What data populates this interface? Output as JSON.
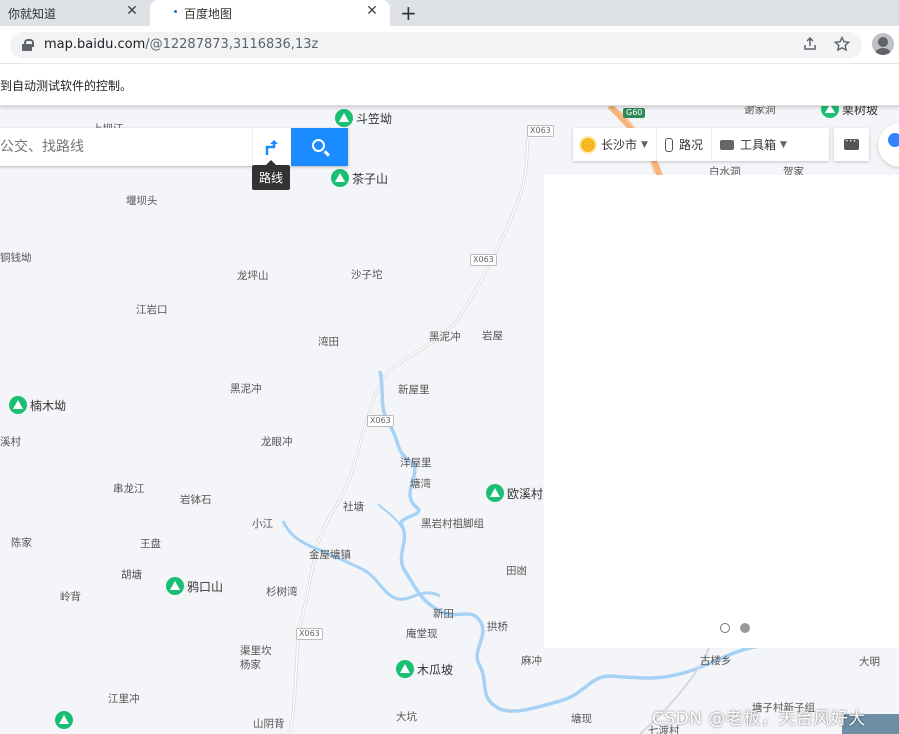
{
  "browser": {
    "tabs": [
      {
        "title": "你就知道",
        "close": "✕"
      },
      {
        "title": "百度地图",
        "close": "✕"
      }
    ],
    "new_tab": "+",
    "url_main": "map.baidu.com",
    "url_rest": "/@12287873,3116836,13z",
    "info_bar": "到自动测试软件的控制。"
  },
  "map": {
    "search_placeholder": "公交、找路线",
    "route_tooltip": "路线",
    "toolbar": {
      "city": "长沙市",
      "traffic": "路况",
      "toolbox": "工具箱"
    },
    "road_tags": [
      "X063",
      "X063",
      "X063",
      "X063"
    ],
    "highway_tag": "G60",
    "pois": [
      "斗笠坳",
      "茶子山",
      "楠木坳",
      "欧溪村",
      "鸦口山",
      "木瓜坡",
      "栗树坡"
    ],
    "places": [
      "上坝江",
      "堰坝头",
      "铜钱坳",
      "龙坪山",
      "沙子坨",
      "江岩口",
      "湾田",
      "黑泥冲",
      "岩屋",
      "黑泥冲",
      "新屋里",
      "龙眼冲",
      "溪村",
      "洋屋里",
      "塘湾",
      "串龙江",
      "岩钵石",
      "社塘",
      "小江",
      "黑岩村祖脚组",
      "陈家",
      "王盘",
      "金屋塘镇",
      "胡塘",
      "田凼",
      "岭背",
      "杉树湾",
      "新田",
      "拱桥",
      "庵堂现",
      "渠里坎",
      "杨家",
      "麻冲",
      "古楼乡",
      "大明",
      "江里冲",
      "大坑",
      "塘现",
      "七渡村",
      "山阴背",
      "白水洞",
      "贺家",
      "谢家洞",
      "塘子村新子组"
    ],
    "watermark": "CSDN @老板，天台风好大"
  }
}
